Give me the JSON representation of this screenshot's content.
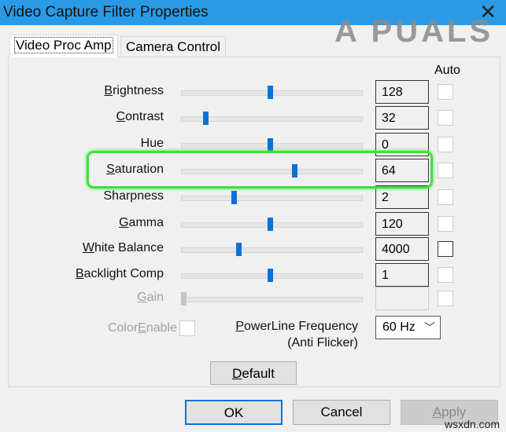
{
  "window": {
    "title": "Video Capture Filter Properties",
    "close_icon": "close-icon"
  },
  "watermark": {
    "logo": "A PUALS",
    "site": "wsxdn.com"
  },
  "tabs": [
    {
      "label": "Video Proc Amp",
      "active": true
    },
    {
      "label": "Camera Control",
      "active": false
    }
  ],
  "auto_header": "Auto",
  "properties": [
    {
      "pre": "",
      "key": "B",
      "post": "rightness",
      "value": "128",
      "slider": 0.5,
      "enabled": true,
      "auto": false
    },
    {
      "pre": "",
      "key": "C",
      "post": "ontrast",
      "value": "32",
      "slider": 0.125,
      "enabled": true,
      "auto": false
    },
    {
      "pre": "Hue",
      "key": "",
      "post": "",
      "value": "0",
      "slider": 0.5,
      "enabled": true,
      "auto": false
    },
    {
      "pre": "",
      "key": "S",
      "post": "aturation",
      "value": "64",
      "slider": 0.64,
      "enabled": true,
      "auto": false
    },
    {
      "pre": "Sharpness",
      "key": "",
      "post": "",
      "value": "2",
      "slider": 0.29,
      "enabled": true,
      "auto": false
    },
    {
      "pre": "",
      "key": "G",
      "post": "amma",
      "value": "120",
      "slider": 0.5,
      "enabled": true,
      "auto": false
    },
    {
      "pre": "",
      "key": "W",
      "post": "hite Balance",
      "value": "4000",
      "slider": 0.32,
      "enabled": true,
      "auto": false,
      "focused": true
    },
    {
      "pre": "",
      "key": "B",
      "post": "acklight Comp",
      "value": "1",
      "slider": 0.5,
      "enabled": true,
      "auto": false
    },
    {
      "pre": "",
      "key": "G",
      "post": "ain",
      "value": "",
      "slider": 0,
      "enabled": false,
      "auto": false
    }
  ],
  "color_enable": {
    "pre": "Color",
    "key": "E",
    "post": "nable",
    "checked": false
  },
  "powerline": {
    "key": "P",
    "post": "owerLine Frequency",
    "line2": "(Anti Flicker)",
    "value": "60 Hz"
  },
  "buttons": {
    "default_key": "D",
    "default_post": "efault",
    "ok": "OK",
    "cancel": "Cancel",
    "apply_key": "A",
    "apply_post": "pply"
  },
  "highlight_color": "#3ee23a"
}
